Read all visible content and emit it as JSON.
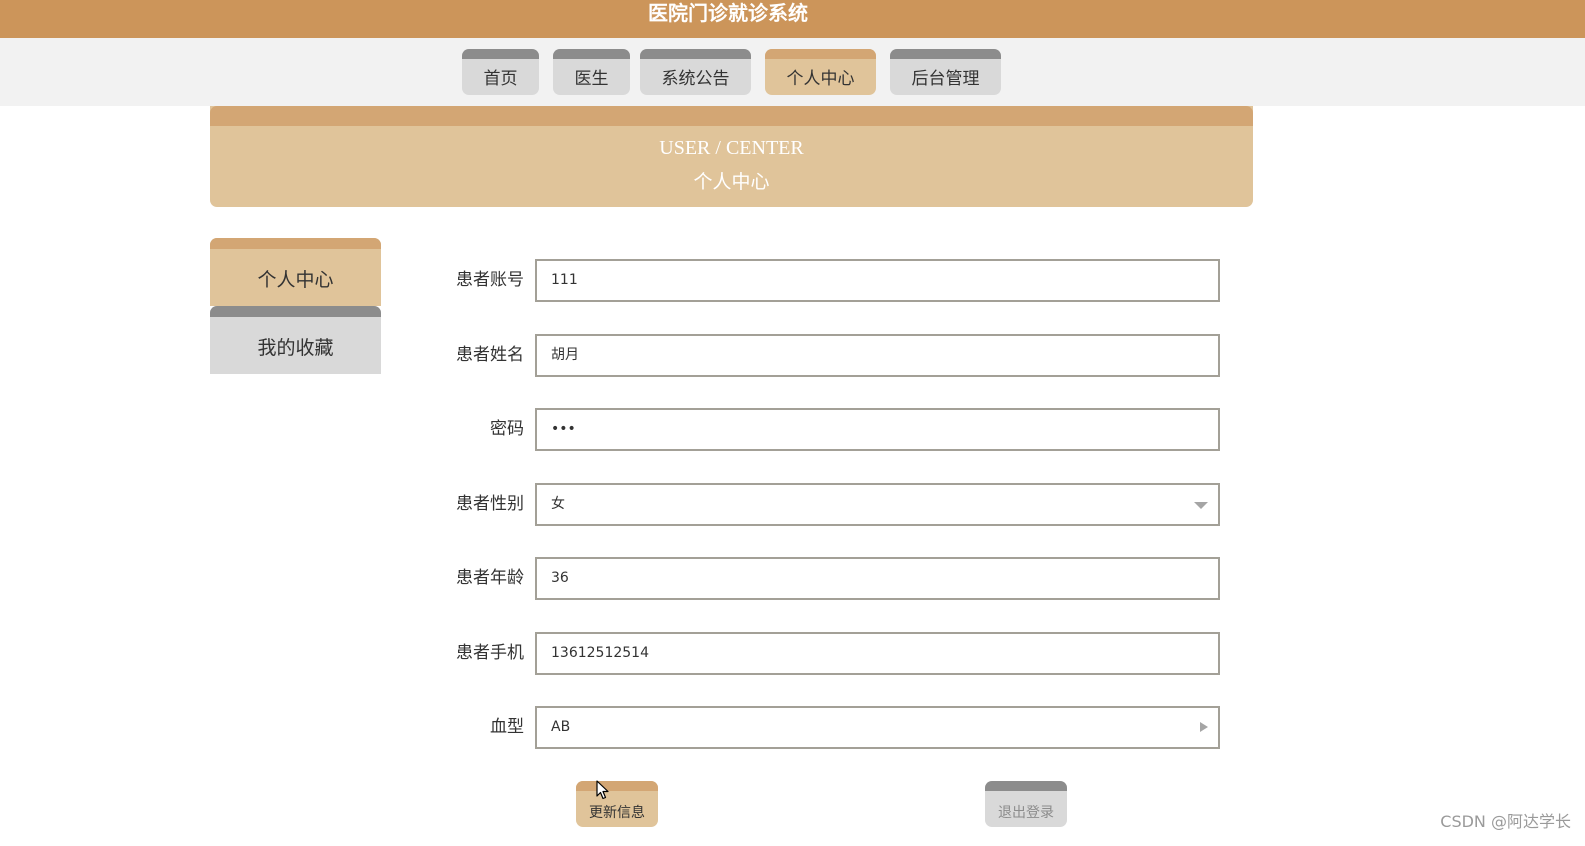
{
  "header": {
    "title": "医院门诊就诊系统"
  },
  "nav": {
    "tabs": [
      {
        "label": "首页"
      },
      {
        "label": "医生"
      },
      {
        "label": "系统公告"
      },
      {
        "label": "个人中心",
        "active": true
      },
      {
        "label": "后台管理"
      }
    ]
  },
  "banner": {
    "title_en": "USER / CENTER",
    "title_cn": "个人中心"
  },
  "sidebar": {
    "items": [
      {
        "label": "个人中心",
        "active": true
      },
      {
        "label": "我的收藏"
      }
    ]
  },
  "form": {
    "account": {
      "label": "患者账号",
      "value": "111"
    },
    "name": {
      "label": "患者姓名",
      "value": "胡月"
    },
    "password": {
      "label": "密码",
      "value": "•••"
    },
    "gender": {
      "label": "患者性别",
      "value": "女"
    },
    "age": {
      "label": "患者年龄",
      "value": "36"
    },
    "phone": {
      "label": "患者手机",
      "value": "13612512514"
    },
    "blood": {
      "label": "血型",
      "value": "AB"
    }
  },
  "buttons": {
    "update": "更新信息",
    "logout": "退出登录"
  },
  "watermark": "CSDN @阿达学长",
  "colors": {
    "brand": "#CC955A",
    "accent_light": "#E0C49A",
    "accent_dark": "#D3A674",
    "inactive_tab": "#D9D9D9",
    "inactive_tab_top": "#8C8C8C"
  }
}
